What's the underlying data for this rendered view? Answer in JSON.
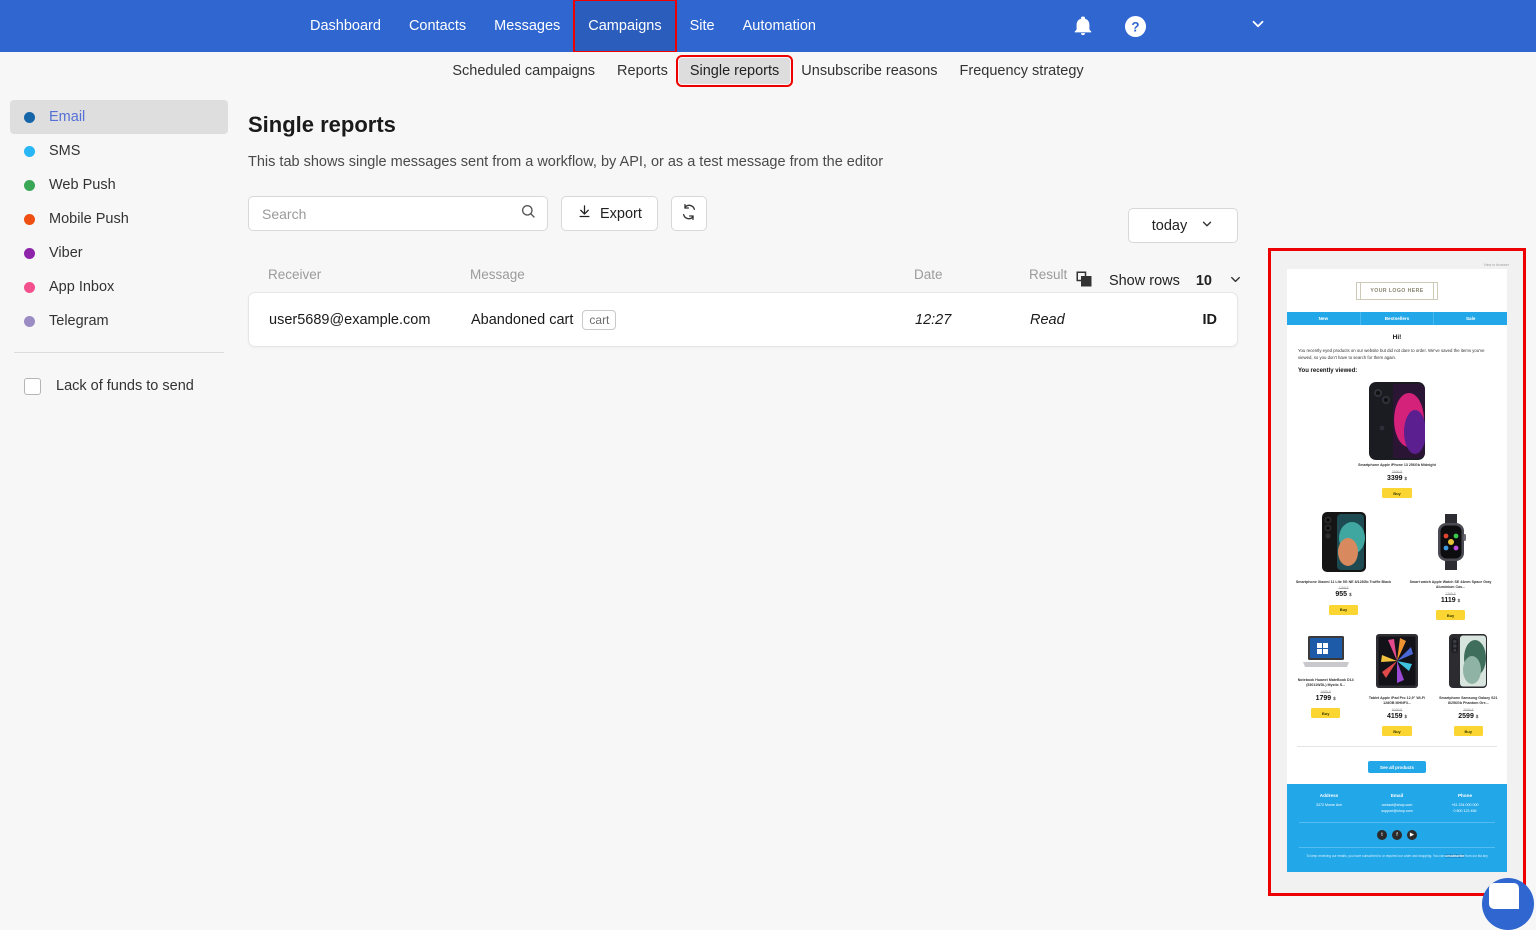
{
  "topnav": {
    "links": [
      {
        "label": "Dashboard",
        "state": "normal"
      },
      {
        "label": "Contacts",
        "state": "normal"
      },
      {
        "label": "Messages",
        "state": "normal"
      },
      {
        "label": "Campaigns",
        "state": "active-highlighted"
      },
      {
        "label": "Site",
        "state": "normal"
      },
      {
        "label": "Automation",
        "state": "normal"
      }
    ],
    "icons": [
      "bell-icon",
      "help-icon",
      "chevron-down-icon"
    ],
    "background_color": "#2f66cf"
  },
  "subnav": {
    "items": [
      {
        "label": "Scheduled campaigns",
        "selected": false
      },
      {
        "label": "Reports",
        "selected": false
      },
      {
        "label": "Single reports",
        "selected": true
      },
      {
        "label": "Unsubscribe reasons",
        "selected": false
      },
      {
        "label": "Frequency strategy",
        "selected": false
      }
    ]
  },
  "sidebar": {
    "items": [
      {
        "label": "Email",
        "color": "#1565a8",
        "active": true
      },
      {
        "label": "SMS",
        "color": "#29b6f6",
        "active": false
      },
      {
        "label": "Web Push",
        "color": "#3aa757",
        "active": false
      },
      {
        "label": "Mobile Push",
        "color": "#ef4f13",
        "active": false
      },
      {
        "label": "Viber",
        "color": "#8e24aa",
        "active": false
      },
      {
        "label": "App Inbox",
        "color": "#f4508d",
        "active": false
      },
      {
        "label": "Telegram",
        "color": "#9b8cc4",
        "active": false
      }
    ],
    "funds_label": "Lack of funds to send",
    "funds_checked": false
  },
  "main": {
    "title": "Single reports",
    "subtitle": "This tab shows single messages sent from a workflow, by API, or as a test message from the editor",
    "search": {
      "value": "",
      "placeholder": "Search"
    },
    "export_label": "Export",
    "refresh_icon": "refresh-icon",
    "date_filter": {
      "value": "today"
    },
    "show_rows": {
      "label": "Show rows",
      "value": "10"
    },
    "copy_icon": "copy-icon"
  },
  "table": {
    "columns": [
      "Receiver",
      "Message",
      "Date",
      "Result",
      ""
    ],
    "rows": [
      {
        "receiver": "user5689@example.com",
        "message": "Abandoned cart",
        "tag": "cart",
        "date": "12:27",
        "result": "Read",
        "result_color": "#34a853",
        "id_label": "ID"
      }
    ]
  },
  "preview": {
    "view_in_browser": "View in browser",
    "logo_text": "YOUR LOGO HERE",
    "nav": [
      "New",
      "Bestsellers",
      "Sale"
    ],
    "greeting": "Hi!",
    "intro": "You recently eyed products on our website but did not dare to order. We've saved the items you've viewed, so you don't have to search for them again.",
    "recent_heading": "You recently viewed:",
    "featured_product": {
      "name": "Smartphone Apple iPhone 13 256Gb Midnight",
      "old_price": "3599 $",
      "price": "3399",
      "currency": "$",
      "buy_label": "Buy"
    },
    "row2": [
      {
        "name": "Smartphone Xiaomi 11 Lite 5G NE 8/128Gb Truffle Black",
        "old_price": "1199 $",
        "price": "955",
        "currency": "$",
        "buy_label": "Buy"
      },
      {
        "name": "Smart watch Apple Watch SE 44mm Space Gray Aluminium Cas...",
        "old_price": "1399 $",
        "price": "1119",
        "currency": "$",
        "buy_label": "Buy"
      }
    ],
    "row3": [
      {
        "name": "Notebook Huawei MateBook D14 (53011WDL) Mystic S...",
        "old_price": "1999 $",
        "price": "1799",
        "currency": "$",
        "buy_label": "Buy"
      },
      {
        "name": "Tablet Apple iPad Pro 12,9\" Wi-Fi 128GB MHNF3...",
        "old_price": "5099 $",
        "price": "4159",
        "currency": "$",
        "buy_label": "Buy"
      },
      {
        "name": "Smartphone Samsung Galaxy S21 8/256Gb Phantom Gre...",
        "old_price": "2899 $",
        "price": "2599",
        "currency": "$",
        "buy_label": "Buy"
      }
    ],
    "see_all_label": "See all products",
    "footer": {
      "columns": [
        {
          "title": "Address",
          "lines": [
            "3372 Morse Ave"
          ]
        },
        {
          "title": "Email",
          "lines": [
            "contact@shop.com",
            "support@shop.com"
          ]
        },
        {
          "title": "Phone",
          "lines": [
            "+61 234 000 000",
            "0 800 123 456"
          ]
        }
      ],
      "socials": [
        "twitter-icon",
        "facebook-icon",
        "youtube-icon"
      ],
      "unsubscribe_text": "To keep receiving our emails, you have subscribed to or required our order and shopping. You can",
      "unsubscribe_link": "unsubscribe",
      "unsubscribe_tail": "from our list any"
    },
    "accent_color": "#22a7e8",
    "buy_button_color": "#fbd531"
  }
}
